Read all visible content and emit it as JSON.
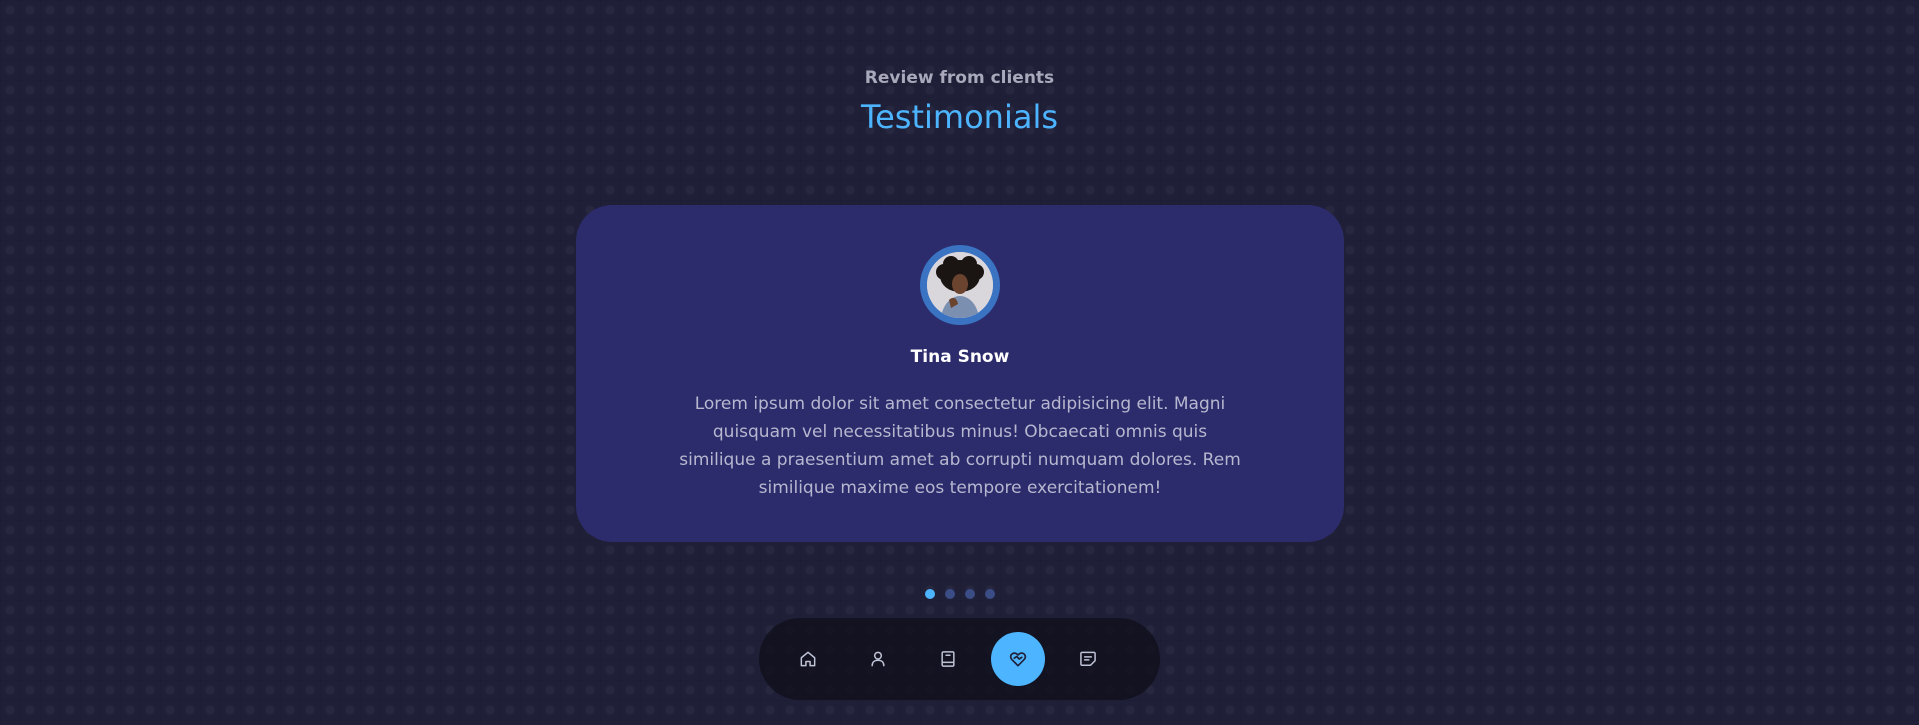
{
  "section": {
    "subtitle": "Review from clients",
    "title": "Testimonials"
  },
  "testimonial": {
    "avatar_icon": "client-avatar",
    "name": "Tina Snow",
    "review": "Lorem ipsum dolor sit amet consectetur adipisicing elit. Magni quisquam vel necessitatibus minus! Obcaecati omnis quis similique a praesentium amet ab corrupti numquam dolores. Rem similique maxime eos tempore exercitationem!"
  },
  "pagination": {
    "total": 4,
    "active_index": 0
  },
  "nav": {
    "items": [
      {
        "icon": "home-icon",
        "active": false
      },
      {
        "icon": "user-icon",
        "active": false
      },
      {
        "icon": "book-icon",
        "active": false
      },
      {
        "icon": "heart-handshake-icon",
        "active": true
      },
      {
        "icon": "message-icon",
        "active": false
      }
    ]
  },
  "colors": {
    "accent": "#4db5ff",
    "card": "#2c2c6c",
    "background": "#1f1f38"
  }
}
